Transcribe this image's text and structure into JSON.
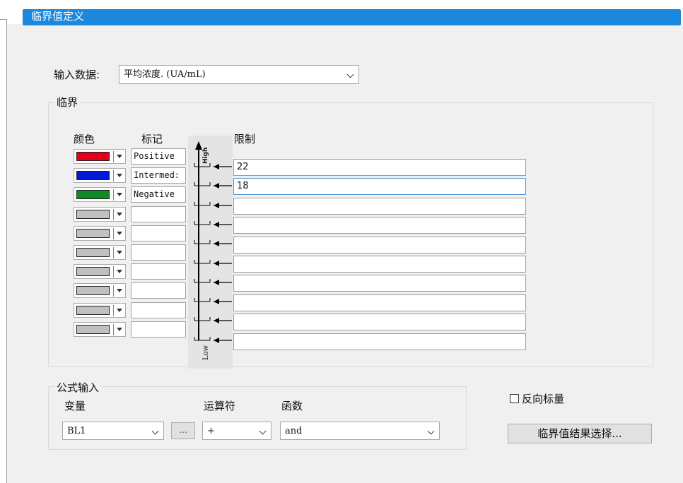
{
  "window": {
    "title": "临界值定义"
  },
  "input_data": {
    "label": "输入数据:",
    "value": "平均浓度. (UA/mL)"
  },
  "threshold": {
    "group_label": "临界",
    "col_color": "颜色",
    "col_mark": "标记",
    "col_limit": "限制",
    "scale_high": "High",
    "scale_low": "Low",
    "rows": [
      {
        "color": "#e3001b",
        "mark": "Positive",
        "limit": "22"
      },
      {
        "color": "#0019d8",
        "mark": "Intermed:",
        "limit": "18"
      },
      {
        "color": "#118a26",
        "mark": "Negative",
        "limit": ""
      },
      {
        "color": "#c0c0c0",
        "mark": "",
        "limit": ""
      },
      {
        "color": "#c0c0c0",
        "mark": "",
        "limit": ""
      },
      {
        "color": "#c0c0c0",
        "mark": "",
        "limit": ""
      },
      {
        "color": "#c0c0c0",
        "mark": "",
        "limit": ""
      },
      {
        "color": "#c0c0c0",
        "mark": "",
        "limit": ""
      },
      {
        "color": "#c0c0c0",
        "mark": "",
        "limit": ""
      },
      {
        "color": "#c0c0c0",
        "mark": "",
        "limit": ""
      }
    ]
  },
  "formula": {
    "group_label": "公式输入",
    "variable_label": "变量",
    "variable_value": "BL1",
    "ellipsis_label": "...",
    "operator_label": "运算符",
    "operator_value": "+",
    "function_label": "函数",
    "function_value": "and"
  },
  "reverse_scale": {
    "label": "反向标量",
    "checked": false
  },
  "result_button": {
    "label": "临界值结果选择..."
  },
  "colors": {
    "title_bar": "#1b87dd",
    "background": "#f0f0f0"
  }
}
